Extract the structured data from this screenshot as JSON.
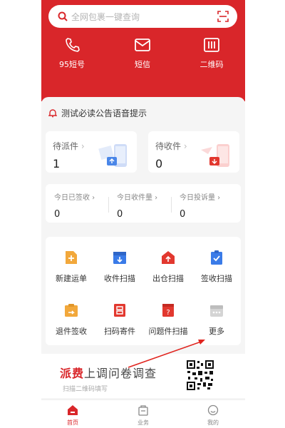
{
  "search": {
    "placeholder": "全网包裹一键查询",
    "icon": "search-icon",
    "scan_icon": "scan-icon"
  },
  "quick_actions": [
    {
      "label": "95短号",
      "icon": "phone-icon"
    },
    {
      "label": "短信",
      "icon": "mail-icon"
    },
    {
      "label": "二维码",
      "icon": "qrcode-icon"
    }
  ],
  "notice": {
    "text": "测试必读公告语音提示",
    "icon": "bell-icon"
  },
  "tiles": [
    {
      "label": "待派件",
      "chevron": "›",
      "count": "1"
    },
    {
      "label": "待收件",
      "chevron": "›",
      "count": "0"
    }
  ],
  "stats": [
    {
      "label": "今日已签收 ›",
      "value": "0"
    },
    {
      "label": "今日收件量 ›",
      "value": "0"
    },
    {
      "label": "今日投诉量 ›",
      "value": "0"
    }
  ],
  "grid": [
    {
      "label": "新建运单",
      "icon": "new-waybill-icon",
      "color": "#f2a83b"
    },
    {
      "label": "收件扫描",
      "icon": "receive-scan-icon",
      "color": "#3a7be8"
    },
    {
      "label": "出仓扫描",
      "icon": "outbound-scan-icon",
      "color": "#e2382f"
    },
    {
      "label": "签收扫描",
      "icon": "sign-scan-icon",
      "color": "#3a7be8"
    },
    {
      "label": "退件签收",
      "icon": "return-sign-icon",
      "color": "#f2a83b"
    },
    {
      "label": "扫码寄件",
      "icon": "scan-send-icon",
      "color": "#e2382f"
    },
    {
      "label": "问题件扫描",
      "icon": "problem-scan-icon",
      "color": "#e2382f"
    },
    {
      "label": "更多",
      "icon": "more-icon",
      "color": "#c8c8c8"
    }
  ],
  "banner": {
    "title_accent": "派费",
    "title_rest": "上调问卷调查",
    "subtitle": "扫描二维码填写"
  },
  "tabs": [
    {
      "label": "首页",
      "icon": "home-icon",
      "active": true
    },
    {
      "label": "业务",
      "icon": "business-icon",
      "active": false
    },
    {
      "label": "我的",
      "icon": "profile-icon",
      "active": false
    }
  ],
  "colors": {
    "brand": "#d9262a",
    "background": "#f5f5f5"
  }
}
